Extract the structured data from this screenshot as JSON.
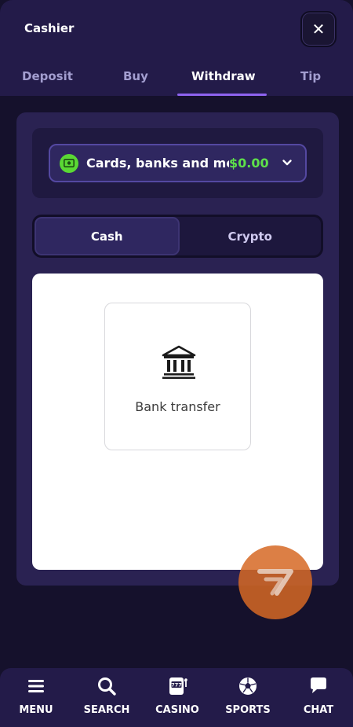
{
  "header": {
    "title": "Cashier",
    "close_label": "✕"
  },
  "tabs": [
    {
      "label": "Deposit"
    },
    {
      "label": "Buy"
    },
    {
      "label": "Withdraw",
      "active": true
    },
    {
      "label": "Tip"
    }
  ],
  "method": {
    "label": "Cards, banks and more",
    "amount": "$0.00",
    "icon": "cash-icon"
  },
  "segment": {
    "cash": "Cash",
    "crypto": "Crypto",
    "selected": "Cash"
  },
  "options": [
    {
      "label": "Bank transfer",
      "icon": "bank-icon"
    }
  ],
  "bottom_nav": [
    {
      "label": "MENU",
      "icon": "menu-icon"
    },
    {
      "label": "SEARCH",
      "icon": "search-icon"
    },
    {
      "label": "CASINO",
      "icon": "slot-machine-icon"
    },
    {
      "label": "SPORTS",
      "icon": "soccer-ball-icon"
    },
    {
      "label": "CHAT",
      "icon": "chat-bubble-icon"
    }
  ],
  "colors": {
    "background": "#15112c",
    "surface": "#231b49",
    "panel": "#2a2252",
    "accent": "#8e63ef",
    "money_green": "#5ee04a",
    "promo_orange": "#d66824"
  }
}
